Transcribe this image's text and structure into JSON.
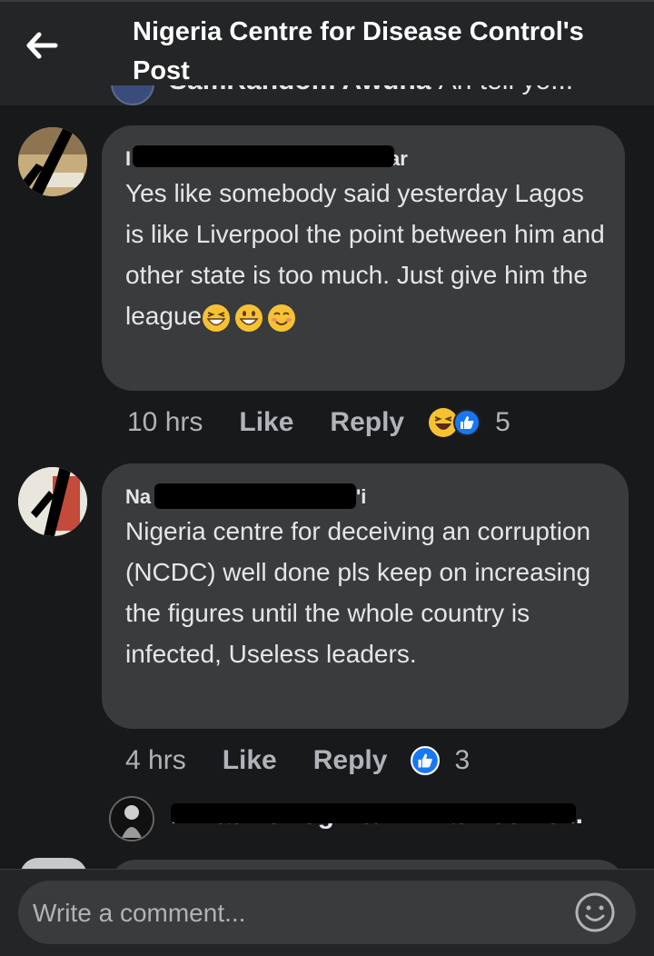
{
  "header": {
    "title": "Nigeria Centre for Disease Control's Post"
  },
  "peek": {
    "author": "SamRandom Awuna",
    "text": "An tell yo..."
  },
  "comments": [
    {
      "author_visible": "I",
      "author_tail": "ar",
      "text": "Yes like somebody said yesterday Lagos is like Liverpool the point between him and other state is too much. Just give him the league",
      "emojis": [
        "grinning-squinting-face",
        "grinning-face",
        "smiling-face"
      ],
      "time": "10 hrs",
      "like": "Like",
      "reply": "Reply",
      "reactions": [
        "laughing-reaction",
        "like-reaction"
      ],
      "reaction_count": "5"
    },
    {
      "author_visible": "Na",
      "author_tail": "'i",
      "text": "Nigeria centre for deceiving an corruption (NCDC) well done pls keep on increasing the figures until the whole country is infected, Useless leaders.",
      "time": "4 hrs",
      "like": "Like",
      "reply": "Reply",
      "reactions": [
        "like-reaction"
      ],
      "reaction_count": "3"
    }
  ],
  "reply_preview": {
    "text": "Miztah Onog Atunmwa Dechie..."
  },
  "composer": {
    "placeholder": "Write a comment..."
  },
  "colors": {
    "background": "#18191a",
    "bubble": "#3a3b3c",
    "text": "#e4e6eb",
    "meta": "#b0b3b8",
    "like_blue": "#1877f2"
  }
}
